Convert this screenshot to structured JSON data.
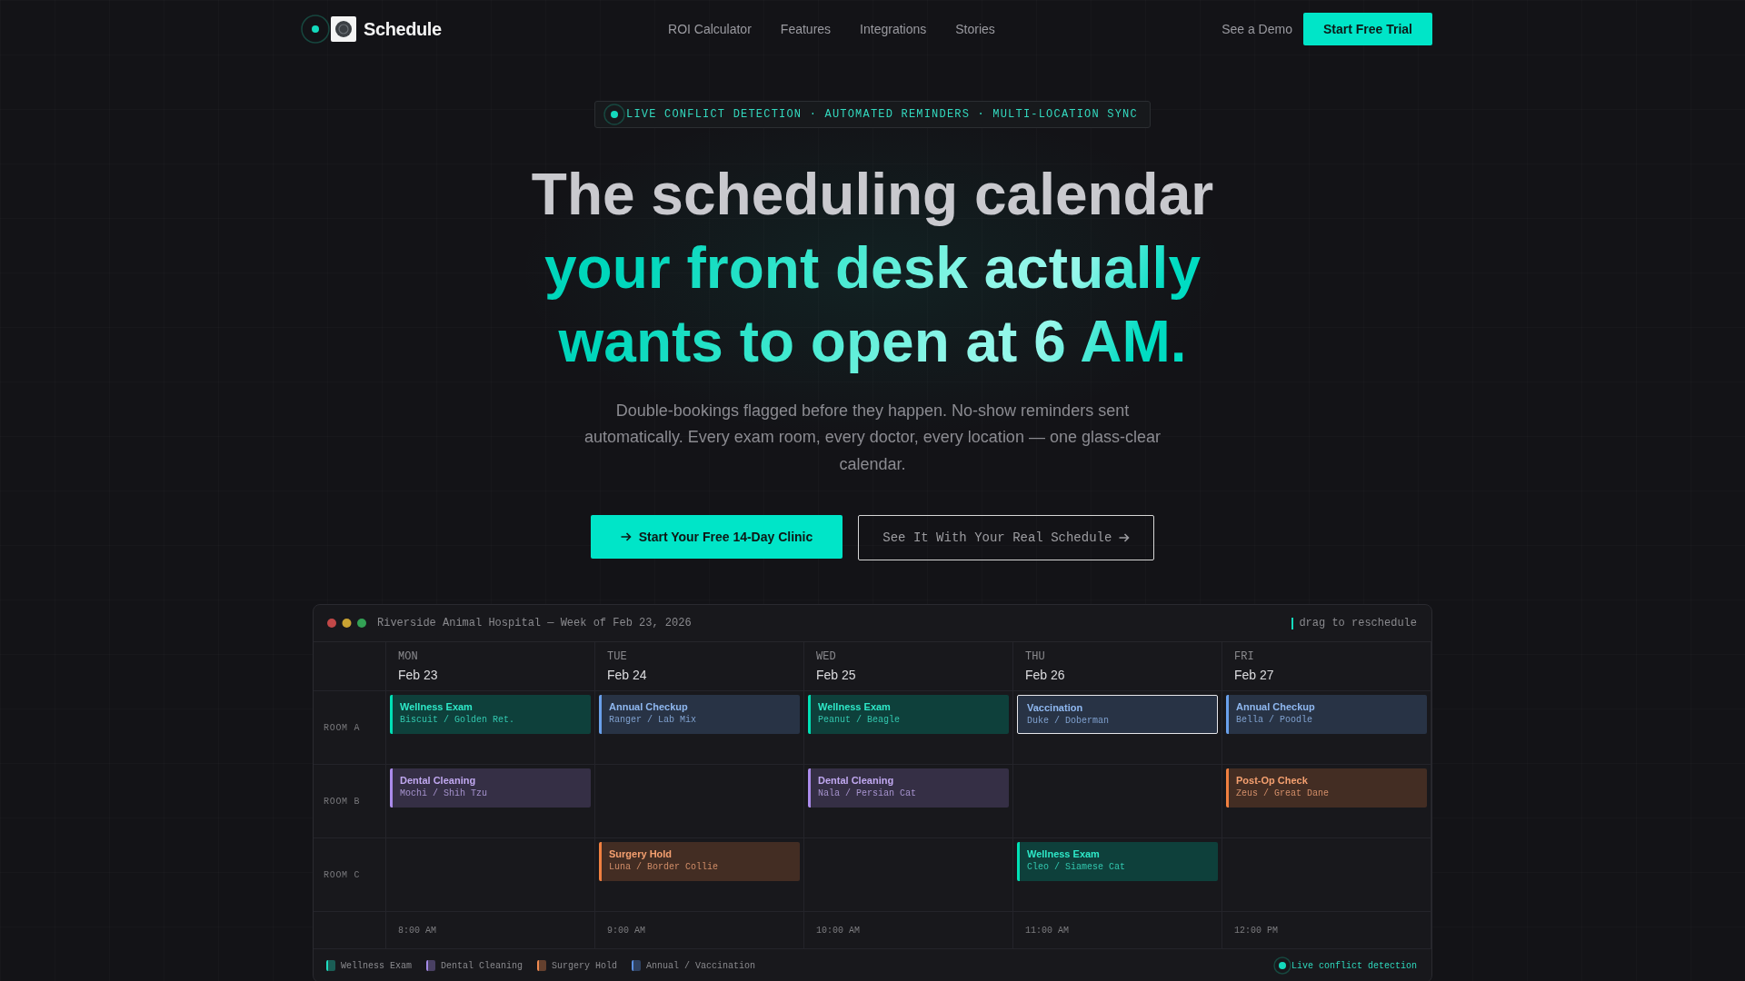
{
  "nav": {
    "brand": "Schedule",
    "links": [
      "ROI Calculator",
      "Features",
      "Integrations",
      "Stories"
    ],
    "secondary_action": "See a Demo",
    "primary_action": "Start Free Trial"
  },
  "hero": {
    "badge": "LIVE CONFLICT DETECTION · AUTOMATED REMINDERS · MULTI-LOCATION SYNC",
    "title_lead": "The scheduling calendar",
    "title_accent": "your front desk actually wants to open at 6 AM.",
    "subtitle": "Double-bookings flagged before they happen. No-show reminders sent automatically. Every exam room, every doctor, every location — one glass-clear calendar.",
    "primary_button": "Start Your Free 14-Day Clinic",
    "secondary_button": "See It With Your Real Schedule"
  },
  "calendar": {
    "title": "Riverside Animal Hospital — Week of Feb 23, 2026",
    "hint": "drag to reschedule",
    "days": [
      {
        "weekday": "MON",
        "date": "Feb 23"
      },
      {
        "weekday": "TUE",
        "date": "Feb 24"
      },
      {
        "weekday": "WED",
        "date": "Feb 25"
      },
      {
        "weekday": "THU",
        "date": "Feb 26"
      },
      {
        "weekday": "FRI",
        "date": "Feb 27"
      }
    ],
    "rooms": [
      {
        "label": "ROOM A",
        "slots": [
          {
            "kind": "appointment",
            "title": "Wellness Exam",
            "patient": "Biscuit / Golden Ret.",
            "color": "#2ee8c8",
            "selected": false
          },
          {
            "kind": "appointment",
            "title": "Annual Checkup",
            "patient": "Ranger / Lab Mix",
            "color": "#8fb8f0",
            "selected": false
          },
          {
            "kind": "appointment",
            "title": "Wellness Exam",
            "patient": "Peanut / Beagle",
            "color": "#2ee8c8",
            "selected": false
          },
          {
            "kind": "appointment",
            "title": "Vaccination",
            "patient": "Duke / Doberman",
            "color": "#8fb8f0",
            "selected": true
          },
          {
            "kind": "appointment",
            "title": "Annual Checkup",
            "patient": "Bella / Poodle",
            "color": "#8fb8f0",
            "selected": false
          }
        ]
      },
      {
        "label": "ROOM B",
        "slots": [
          {
            "kind": "appointment",
            "title": "Dental Cleaning",
            "patient": "Mochi / Shih Tzu",
            "color": "#c0a8f0",
            "selected": false
          },
          {
            "kind": "empty"
          },
          {
            "kind": "appointment",
            "title": "Dental Cleaning",
            "patient": "Nala / Persian Cat",
            "color": "#c0a8f0",
            "selected": false
          },
          {
            "kind": "empty"
          },
          {
            "kind": "appointment",
            "title": "Post-Op Check",
            "patient": "Zeus / Great Dane",
            "color": "#f5a070",
            "selected": false
          }
        ]
      },
      {
        "label": "ROOM C",
        "slots": [
          {
            "kind": "empty"
          },
          {
            "kind": "appointment",
            "title": "Surgery Hold",
            "patient": "Luna / Border Collie",
            "color": "#f5a070",
            "selected": false
          },
          {
            "kind": "empty"
          },
          {
            "kind": "appointment",
            "title": "Wellness Exam",
            "patient": "Cleo / Siamese Cat",
            "color": "#2ee8c8",
            "selected": false
          },
          {
            "kind": "empty"
          }
        ]
      }
    ],
    "times": [
      "8:00 AM",
      "9:00 AM",
      "10:00 AM",
      "11:00 AM",
      "12:00 PM"
    ],
    "legend": [
      {
        "label": "Wellness Exam",
        "color": "#1fdcc0"
      },
      {
        "label": "Dental Cleaning",
        "color": "#a48ae6"
      },
      {
        "label": "Surgery Hold",
        "color": "#f08a50"
      },
      {
        "label": "Annual / Vaccination",
        "color": "#5b8fe0"
      }
    ],
    "status": "Live conflict detection"
  }
}
